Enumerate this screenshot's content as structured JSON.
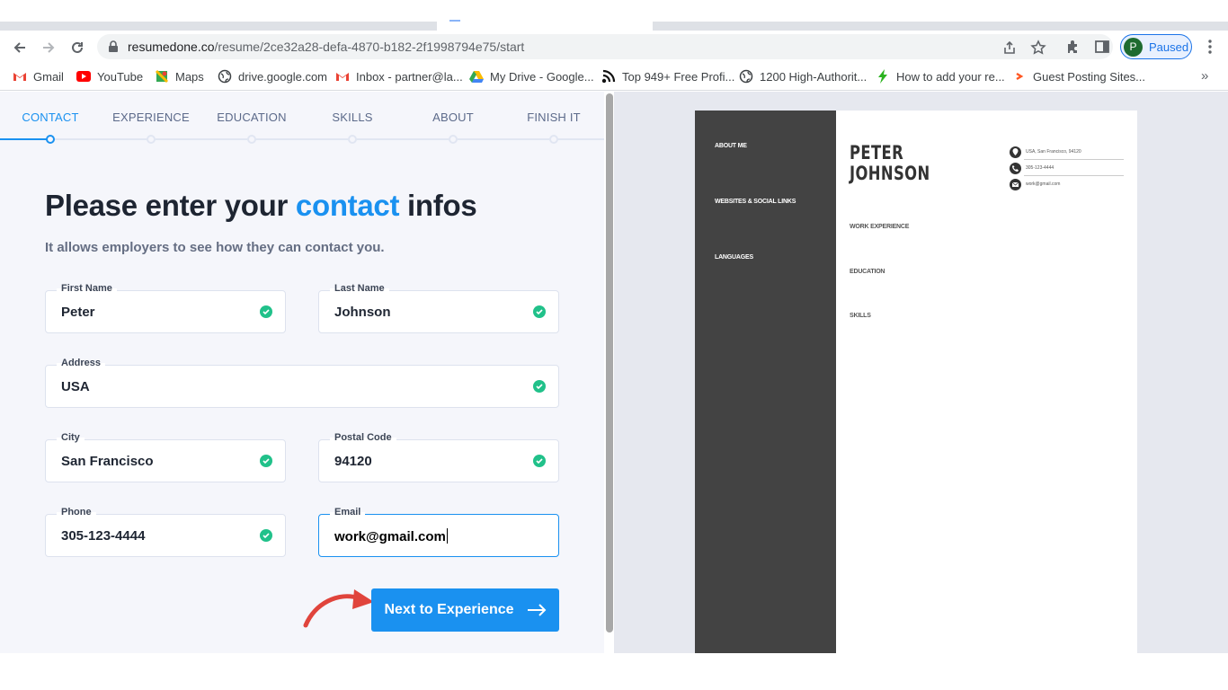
{
  "browser": {
    "url_domain": "resumedone.co",
    "url_path": "/resume/2ce32a28-defa-4870-b182-2f1998794e75/start",
    "profile_initial": "P",
    "profile_status": "Paused"
  },
  "bookmarks": [
    {
      "label": "Gmail",
      "icon": "gmail-icon"
    },
    {
      "label": "YouTube",
      "icon": "youtube-icon"
    },
    {
      "label": "Maps",
      "icon": "maps-icon"
    },
    {
      "label": "drive.google.com",
      "icon": "globe-icon"
    },
    {
      "label": "Inbox - partner@la...",
      "icon": "gmail-icon"
    },
    {
      "label": "My Drive - Google...",
      "icon": "drive-icon"
    },
    {
      "label": "Top 949+ Free Profi...",
      "icon": "site-icon"
    },
    {
      "label": "1200 High-Authorit...",
      "icon": "globe-icon"
    },
    {
      "label": "How to add your re...",
      "icon": "bolt-icon"
    },
    {
      "label": "Guest Posting Sites...",
      "icon": "site-icon"
    }
  ],
  "steps": [
    {
      "label": "CONTACT",
      "active": true
    },
    {
      "label": "EXPERIENCE",
      "active": false
    },
    {
      "label": "EDUCATION",
      "active": false
    },
    {
      "label": "SKILLS",
      "active": false
    },
    {
      "label": "ABOUT",
      "active": false
    },
    {
      "label": "FINISH IT",
      "active": false
    }
  ],
  "form": {
    "heading_pre": "Please enter your ",
    "heading_highlight": "contact",
    "heading_post": " infos",
    "subheading": "It allows employers to see how they can contact you.",
    "fields": {
      "first_name": {
        "label": "First Name",
        "value": "Peter"
      },
      "last_name": {
        "label": "Last Name",
        "value": "Johnson"
      },
      "address": {
        "label": "Address",
        "value": "USA"
      },
      "city": {
        "label": "City",
        "value": "San Francisco"
      },
      "postal_code": {
        "label": "Postal Code",
        "value": "94120"
      },
      "phone": {
        "label": "Phone",
        "value": "305-123-4444"
      },
      "email": {
        "label": "Email",
        "value": "work@gmail.com"
      }
    },
    "next_button": "Next to Experience"
  },
  "preview": {
    "sidebar_sections": [
      "ABOUT ME",
      "WEBSITES & SOCIAL LINKS",
      "LANGUAGES"
    ],
    "first_name": "PETER",
    "last_name": "JOHNSON",
    "contact": {
      "location": "USA, San Francisco, 94120",
      "phone": "305-123-4444",
      "email": "work@gmail.com"
    },
    "sections": [
      "WORK EXPERIENCE",
      "EDUCATION",
      "SKILLS"
    ]
  },
  "colors": {
    "accent": "#1a91f0",
    "check": "#21c18a",
    "resume_sidebar": "#434343",
    "annotation_arrow": "#e0443c"
  }
}
